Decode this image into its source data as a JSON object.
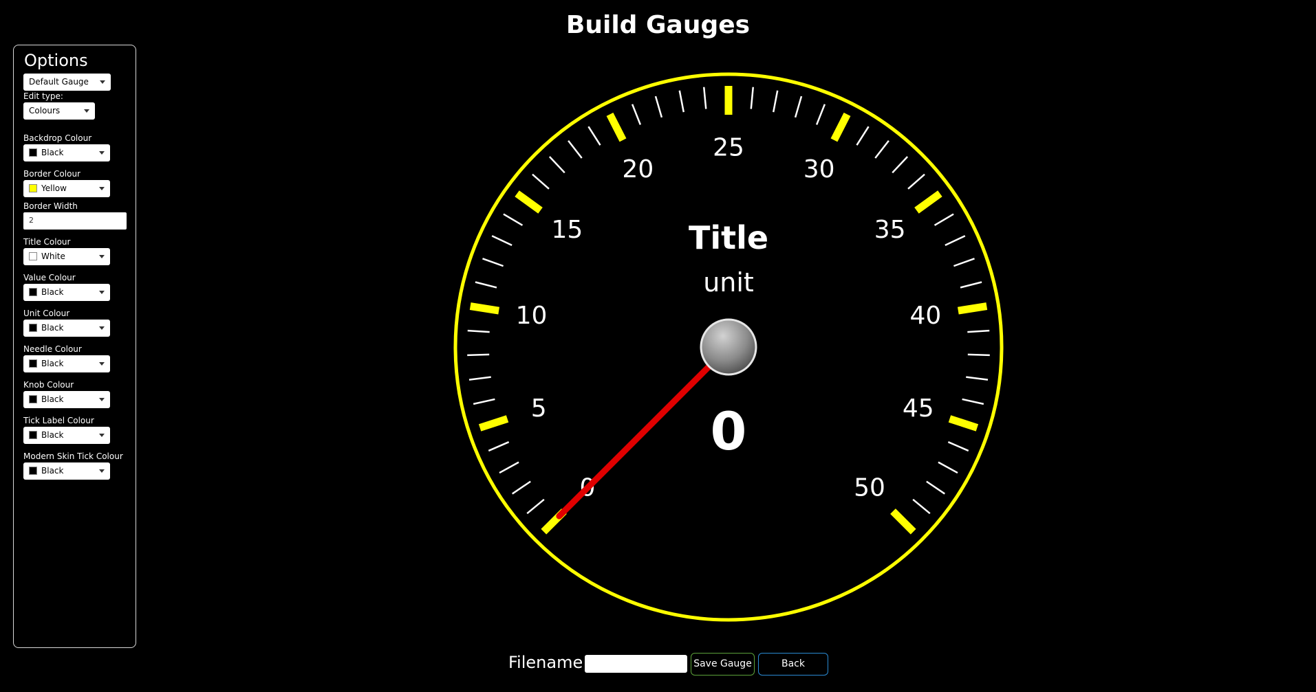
{
  "page": {
    "title": "Build Gauges"
  },
  "options": {
    "title": "Options",
    "gauge_select": "Default Gauge",
    "edit_type_label": "Edit type:",
    "edit_type_value": "Colours",
    "fields": [
      {
        "label": "Backdrop Colour",
        "value": "Black",
        "swatch": "#000000"
      },
      {
        "label": "Border Colour",
        "value": "Yellow",
        "swatch": "#ffff00"
      },
      {
        "label": "Border Width",
        "value": "2"
      },
      {
        "label": "Title Colour",
        "value": "White",
        "swatch": "#ffffff"
      },
      {
        "label": "Value Colour",
        "value": "Black",
        "swatch": "#000000"
      },
      {
        "label": "Unit Colour",
        "value": "Black",
        "swatch": "#000000"
      },
      {
        "label": "Needle Colour",
        "value": "Black",
        "swatch": "#000000"
      },
      {
        "label": "Knob Colour",
        "value": "Black",
        "swatch": "#000000"
      },
      {
        "label": "Tick Label Colour",
        "value": "Black",
        "swatch": "#000000"
      },
      {
        "label": "Modern Skin Tick Colour",
        "value": "Black",
        "swatch": "#000000"
      }
    ]
  },
  "gauge": {
    "title": "Title",
    "unit": "unit",
    "value": "0",
    "min": 0,
    "max": 50,
    "major_step": 5,
    "minor_per_major": 5,
    "tick_labels": [
      "0",
      "5",
      "10",
      "15",
      "20",
      "25",
      "30",
      "35",
      "40",
      "45",
      "50"
    ],
    "border_color": "#ffff00",
    "major_tick_color": "#ffff00",
    "minor_tick_color": "#ffffff",
    "needle_color": "#e00000",
    "knob_color": "#9a9a9a",
    "text_color": "#ffffff"
  },
  "footer": {
    "filename_label": "Filename:",
    "filename_value": "",
    "save_label": "Save Gauge",
    "back_label": "Back"
  }
}
